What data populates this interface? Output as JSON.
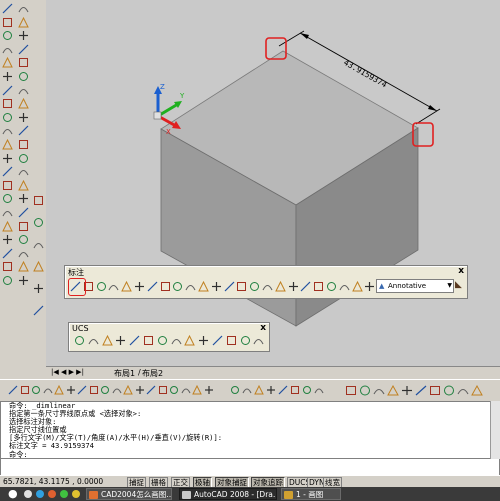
{
  "dimension": {
    "value_text": "43.9159374"
  },
  "toolbars": {
    "dim": {
      "title": "标注",
      "close": "x",
      "dimstyle": "Annotative"
    },
    "ucs": {
      "title": "UCS",
      "close": "x"
    }
  },
  "ucs_icon": {
    "z": "Z",
    "y": "Y",
    "x": "X"
  },
  "layout_tabs": {
    "tab1": "布局1",
    "tab2": "布局2"
  },
  "command_lines": [
    "命令: _dimlinear",
    "指定第一条尺寸界线原点或 <选择对象>:",
    "选择标注对象:",
    "指定尺寸线位置或",
    "[多行文字(M)/文字(T)/角度(A)/水平(H)/垂直(V)/旋转(R)]:",
    "标注文字 = 43.9159374",
    "命令:"
  ],
  "status_bar": {
    "coords": "65.7821,  43.1175 , 0.0000",
    "buttons": [
      "捕捉",
      "栅格",
      "正交",
      "极轴",
      "对象捕捉",
      "对象追踪",
      "DUCS",
      "DYN",
      "线宽"
    ],
    "active_buttons": [
      "极轴",
      "对象捕捉",
      "对象追踪"
    ]
  },
  "taskbar": {
    "items": [
      "CAD2004怎么画图…",
      "AutoCAD 2008 - [Dra…",
      "1 - 画图"
    ]
  },
  "colors": {
    "highlight": "#e02020",
    "canvas": "#c9c9c9",
    "taskbar": "#3a3a3a"
  }
}
